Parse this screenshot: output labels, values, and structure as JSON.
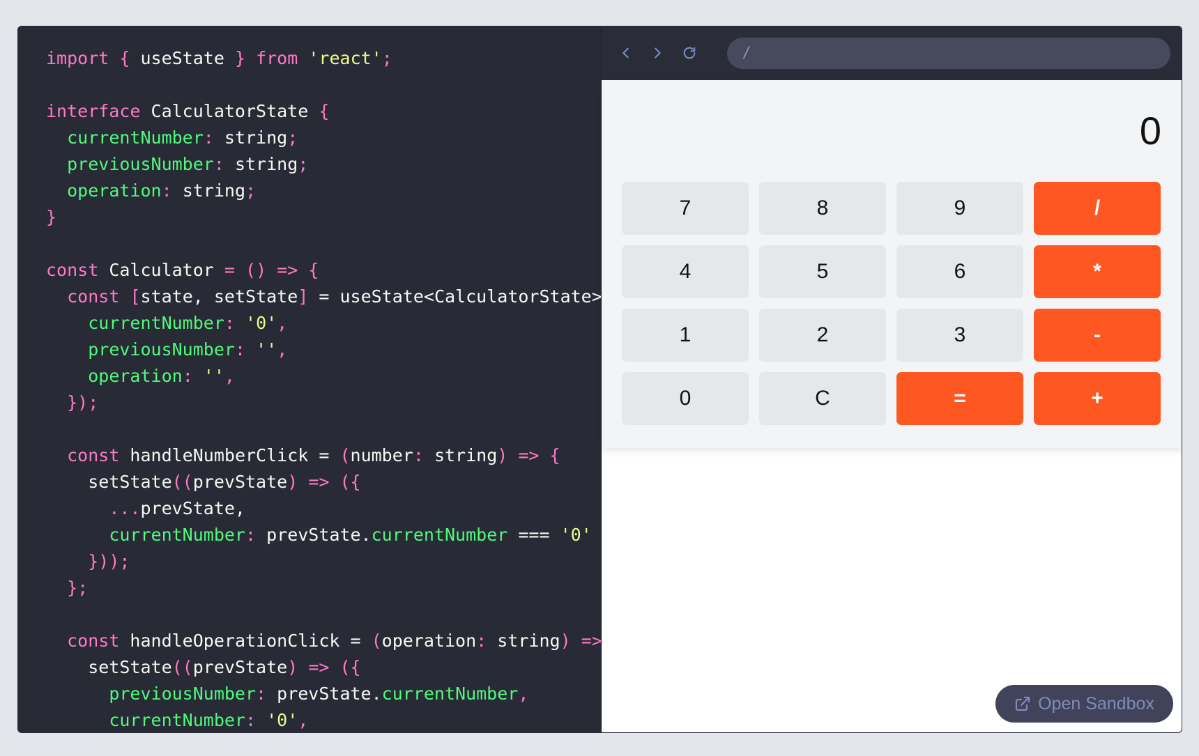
{
  "code": {
    "lines": [
      [
        {
          "c": "k",
          "t": "import"
        },
        {
          "c": "t",
          "t": " "
        },
        {
          "c": "k",
          "t": "{"
        },
        {
          "c": "t",
          "t": " useState "
        },
        {
          "c": "k",
          "t": "}"
        },
        {
          "c": "t",
          "t": " "
        },
        {
          "c": "k",
          "t": "from"
        },
        {
          "c": "t",
          "t": " "
        },
        {
          "c": "s",
          "t": "'react'"
        },
        {
          "c": "k",
          "t": ";"
        }
      ],
      [],
      [
        {
          "c": "k",
          "t": "interface"
        },
        {
          "c": "t",
          "t": " CalculatorState "
        },
        {
          "c": "k",
          "t": "{"
        }
      ],
      [
        {
          "c": "t",
          "t": "  "
        },
        {
          "c": "p",
          "t": "currentNumber"
        },
        {
          "c": "k",
          "t": ":"
        },
        {
          "c": "t",
          "t": " string"
        },
        {
          "c": "k",
          "t": ";"
        }
      ],
      [
        {
          "c": "t",
          "t": "  "
        },
        {
          "c": "p",
          "t": "previousNumber"
        },
        {
          "c": "k",
          "t": ":"
        },
        {
          "c": "t",
          "t": " string"
        },
        {
          "c": "k",
          "t": ";"
        }
      ],
      [
        {
          "c": "t",
          "t": "  "
        },
        {
          "c": "p",
          "t": "operation"
        },
        {
          "c": "k",
          "t": ":"
        },
        {
          "c": "t",
          "t": " string"
        },
        {
          "c": "k",
          "t": ";"
        }
      ],
      [
        {
          "c": "k",
          "t": "}"
        }
      ],
      [],
      [
        {
          "c": "k",
          "t": "const"
        },
        {
          "c": "t",
          "t": " Calculator "
        },
        {
          "c": "o",
          "t": "="
        },
        {
          "c": "t",
          "t": " "
        },
        {
          "c": "k",
          "t": "()"
        },
        {
          "c": "t",
          "t": " "
        },
        {
          "c": "k",
          "t": "=>"
        },
        {
          "c": "t",
          "t": " "
        },
        {
          "c": "k",
          "t": "{"
        }
      ],
      [
        {
          "c": "t",
          "t": "  "
        },
        {
          "c": "k",
          "t": "const"
        },
        {
          "c": "t",
          "t": " "
        },
        {
          "c": "k",
          "t": "["
        },
        {
          "c": "t",
          "t": "state, setState"
        },
        {
          "c": "k",
          "t": "]"
        },
        {
          "c": "t",
          "t": " = useState<CalculatorState>"
        },
        {
          "c": "k",
          "t": "("
        }
      ],
      [
        {
          "c": "t",
          "t": "    "
        },
        {
          "c": "p",
          "t": "currentNumber"
        },
        {
          "c": "k",
          "t": ":"
        },
        {
          "c": "t",
          "t": " "
        },
        {
          "c": "s",
          "t": "'0'"
        },
        {
          "c": "k",
          "t": ","
        }
      ],
      [
        {
          "c": "t",
          "t": "    "
        },
        {
          "c": "p",
          "t": "previousNumber"
        },
        {
          "c": "k",
          "t": ":"
        },
        {
          "c": "t",
          "t": " "
        },
        {
          "c": "s",
          "t": "''"
        },
        {
          "c": "k",
          "t": ","
        }
      ],
      [
        {
          "c": "t",
          "t": "    "
        },
        {
          "c": "p",
          "t": "operation"
        },
        {
          "c": "k",
          "t": ":"
        },
        {
          "c": "t",
          "t": " "
        },
        {
          "c": "s",
          "t": "''"
        },
        {
          "c": "k",
          "t": ","
        }
      ],
      [
        {
          "c": "t",
          "t": "  "
        },
        {
          "c": "k",
          "t": "});"
        }
      ],
      [],
      [
        {
          "c": "t",
          "t": "  "
        },
        {
          "c": "k",
          "t": "const"
        },
        {
          "c": "t",
          "t": " handleNumberClick = "
        },
        {
          "c": "k",
          "t": "("
        },
        {
          "c": "t",
          "t": "number"
        },
        {
          "c": "k",
          "t": ":"
        },
        {
          "c": "t",
          "t": " string"
        },
        {
          "c": "k",
          "t": ")"
        },
        {
          "c": "t",
          "t": " "
        },
        {
          "c": "k",
          "t": "=>"
        },
        {
          "c": "t",
          "t": " "
        },
        {
          "c": "k",
          "t": "{"
        }
      ],
      [
        {
          "c": "t",
          "t": "    setState"
        },
        {
          "c": "k",
          "t": "(("
        },
        {
          "c": "t",
          "t": "prevState"
        },
        {
          "c": "k",
          "t": ")"
        },
        {
          "c": "t",
          "t": " "
        },
        {
          "c": "k",
          "t": "=>"
        },
        {
          "c": "t",
          "t": " "
        },
        {
          "c": "k",
          "t": "({"
        }
      ],
      [
        {
          "c": "t",
          "t": "      "
        },
        {
          "c": "k",
          "t": "..."
        },
        {
          "c": "t",
          "t": "prevState,"
        }
      ],
      [
        {
          "c": "t",
          "t": "      "
        },
        {
          "c": "p",
          "t": "currentNumber"
        },
        {
          "c": "k",
          "t": ":"
        },
        {
          "c": "t",
          "t": " prevState."
        },
        {
          "c": "p",
          "t": "currentNumber"
        },
        {
          "c": "t",
          "t": " === "
        },
        {
          "c": "s",
          "t": "'0'"
        },
        {
          "c": "t",
          "t": " ?"
        }
      ],
      [
        {
          "c": "t",
          "t": "    "
        },
        {
          "c": "k",
          "t": "}));"
        }
      ],
      [
        {
          "c": "t",
          "t": "  "
        },
        {
          "c": "k",
          "t": "};"
        }
      ],
      [],
      [
        {
          "c": "t",
          "t": "  "
        },
        {
          "c": "k",
          "t": "const"
        },
        {
          "c": "t",
          "t": " handleOperationClick = "
        },
        {
          "c": "k",
          "t": "("
        },
        {
          "c": "t",
          "t": "operation"
        },
        {
          "c": "k",
          "t": ":"
        },
        {
          "c": "t",
          "t": " string"
        },
        {
          "c": "k",
          "t": ")"
        },
        {
          "c": "t",
          "t": " "
        },
        {
          "c": "k",
          "t": "=>"
        }
      ],
      [
        {
          "c": "t",
          "t": "    setState"
        },
        {
          "c": "k",
          "t": "(("
        },
        {
          "c": "t",
          "t": "prevState"
        },
        {
          "c": "k",
          "t": ")"
        },
        {
          "c": "t",
          "t": " "
        },
        {
          "c": "k",
          "t": "=>"
        },
        {
          "c": "t",
          "t": " "
        },
        {
          "c": "k",
          "t": "({"
        }
      ],
      [
        {
          "c": "t",
          "t": "      "
        },
        {
          "c": "p",
          "t": "previousNumber"
        },
        {
          "c": "k",
          "t": ":"
        },
        {
          "c": "t",
          "t": " prevState."
        },
        {
          "c": "p",
          "t": "currentNumber"
        },
        {
          "c": "k",
          "t": ","
        }
      ],
      [
        {
          "c": "t",
          "t": "      "
        },
        {
          "c": "p",
          "t": "currentNumber"
        },
        {
          "c": "k",
          "t": ":"
        },
        {
          "c": "t",
          "t": " "
        },
        {
          "c": "s",
          "t": "'0'"
        },
        {
          "c": "k",
          "t": ","
        }
      ]
    ]
  },
  "browser": {
    "back_icon": "chevron-left-icon",
    "forward_icon": "chevron-right-icon",
    "reload_icon": "reload-icon",
    "url": "/"
  },
  "calculator": {
    "display": "0",
    "keys": [
      {
        "label": "7",
        "type": "num"
      },
      {
        "label": "8",
        "type": "num"
      },
      {
        "label": "9",
        "type": "num"
      },
      {
        "label": "/",
        "type": "op"
      },
      {
        "label": "4",
        "type": "num"
      },
      {
        "label": "5",
        "type": "num"
      },
      {
        "label": "6",
        "type": "num"
      },
      {
        "label": "*",
        "type": "op"
      },
      {
        "label": "1",
        "type": "num"
      },
      {
        "label": "2",
        "type": "num"
      },
      {
        "label": "3",
        "type": "num"
      },
      {
        "label": "-",
        "type": "op"
      },
      {
        "label": "0",
        "type": "num"
      },
      {
        "label": "C",
        "type": "num"
      },
      {
        "label": "=",
        "type": "op"
      },
      {
        "label": "+",
        "type": "op"
      }
    ]
  },
  "sandbox": {
    "label": "Open Sandbox",
    "icon": "external-link-icon"
  },
  "colors": {
    "editor_bg": "#282a36",
    "keyword": "#ff79c6",
    "string": "#f1fa8c",
    "property": "#50fa7b",
    "operator_key": "#ff5722",
    "number_key": "#e5e7eb"
  }
}
